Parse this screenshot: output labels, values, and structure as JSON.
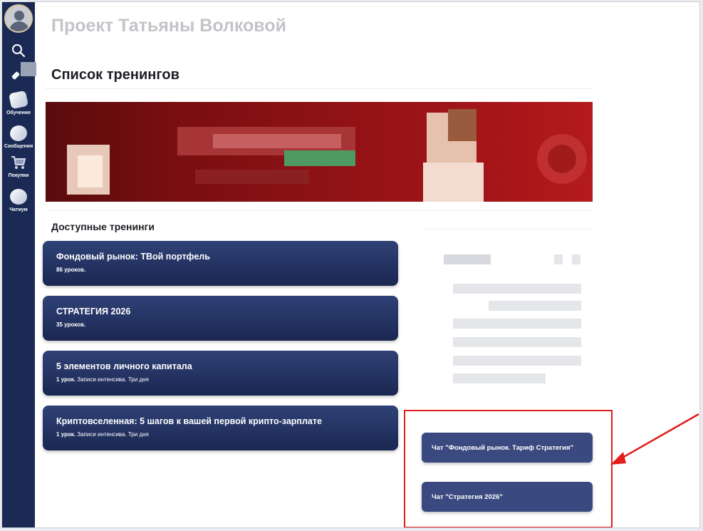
{
  "header": {
    "project_title": "Проект Татьяны Волковой",
    "page_title": "Список тренингов"
  },
  "sidebar": {
    "items": [
      {
        "label": "Обучение",
        "icon": "book-icon"
      },
      {
        "label": "Сообщения",
        "icon": "chat-bubble-icon"
      },
      {
        "label": "Покупки",
        "icon": "cart-icon"
      },
      {
        "label": "Чатиум",
        "icon": "chatium-icon"
      }
    ]
  },
  "trainings": {
    "section_title": "Доступные тренинги",
    "items": [
      {
        "title": "Фондовый рынок: ТВой портфель",
        "lessons": "86 уроков.",
        "note": ""
      },
      {
        "title": "СТРАТЕГИЯ 2026",
        "lessons": "35 уроков.",
        "note": ""
      },
      {
        "title": "5 элементов личного капитала",
        "lessons": "1 урок.",
        "note": " Записи интенсива. Три дня"
      },
      {
        "title": "Криптовселенная: 5 шагов к вашей первой крипто-зарплате",
        "lessons": "1 урок.",
        "note": " Записи интенсива. Три дня"
      }
    ]
  },
  "chats": [
    {
      "label": "Чат \"Фондовый рынок. Тариф Стратегия\""
    },
    {
      "label": "Чат \"Стратегия 2026\""
    }
  ],
  "colors": {
    "sidebar": "#1a2a55",
    "card": "#1f2d5c",
    "chat_button": "#3a4a80",
    "highlight": "#e11d1d"
  }
}
